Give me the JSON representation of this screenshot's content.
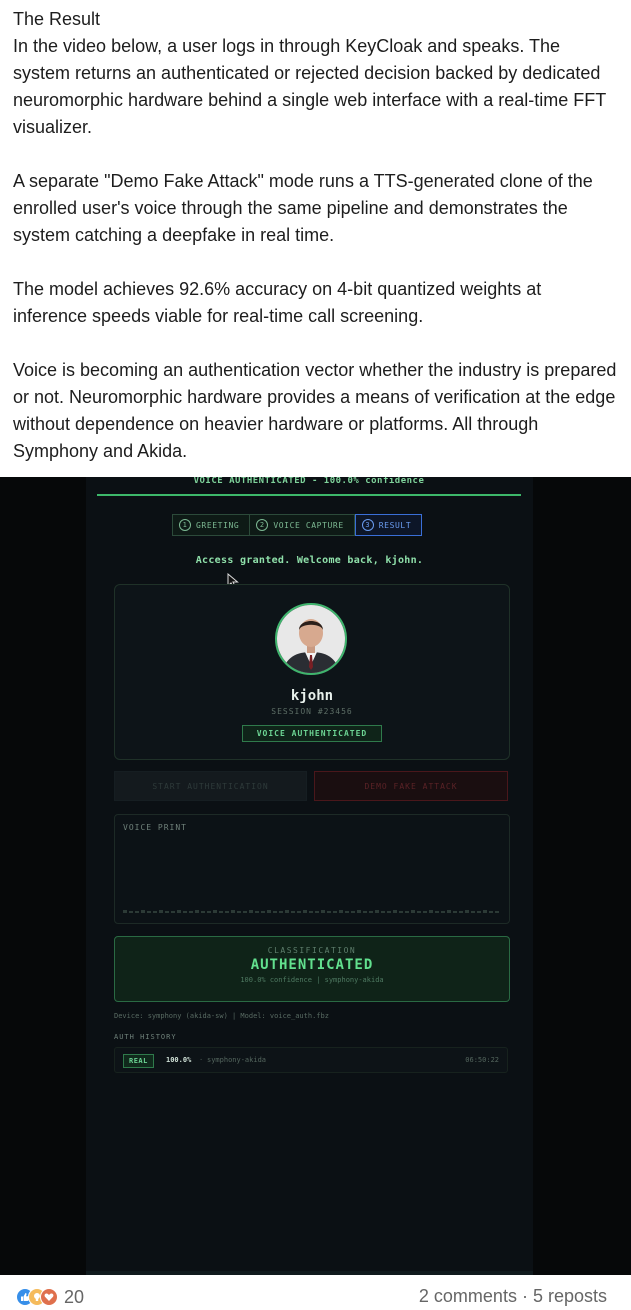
{
  "post": {
    "title": "The Result",
    "paragraphs": [
      "In the video below, a user logs in through KeyCloak and speaks. The system returns an authenticated or rejected decision backed by dedicated neuromorphic hardware behind a single web interface with a real-time FFT visualizer.",
      "A separate \"Demo Fake Attack\" mode runs a TTS-generated clone of the enrolled user's voice through the same pipeline and demonstrates the system catching a deepfake in real time.",
      "The model achieves 92.6% accuracy on 4-bit quantized weights at inference speeds viable for real-time call screening.",
      "Voice is becoming an authentication vector whether the industry is prepared or not. Neuromorphic hardware provides a means of verification at the edge without dependence on heavier hardware or platforms. All through Symphony and Akida."
    ]
  },
  "app": {
    "banner": "VOICE AUTHENTICATED - 100.0% confidence",
    "steps": [
      {
        "num": "1",
        "label": "GREETING"
      },
      {
        "num": "2",
        "label": "VOICE CAPTURE"
      },
      {
        "num": "3",
        "label": "RESULT"
      }
    ],
    "access_message": "Access granted. Welcome back, kjohn.",
    "profile": {
      "username": "kjohn",
      "session": "SESSION #23456",
      "badge": "VOICE AUTHENTICATED"
    },
    "buttons": {
      "start": "START AUTHENTICATION",
      "fake": "DEMO FAKE ATTACK"
    },
    "voice_print": {
      "label": "VOICE PRINT"
    },
    "classification": {
      "label": "CLASSIFICATION",
      "value": "AUTHENTICATED",
      "detail": "100.0% confidence | symphony-akida"
    },
    "device_line": "Device: symphony (akida-sw) | Model: voice_auth.fbz",
    "history": {
      "title": "AUTH HISTORY",
      "rows": [
        {
          "tag": "REAL",
          "confidence": "100.0%",
          "separator": "·",
          "device": "symphony-akida",
          "time": "06:50:22"
        }
      ]
    },
    "colors": {
      "accent_green": "#62e08e",
      "active_step_blue": "#6a9cf0",
      "fake_red": "#5a2226"
    }
  },
  "footer": {
    "reaction_icons": [
      "like-icon",
      "insightful-icon",
      "love-icon"
    ],
    "reaction_count": "20",
    "comments": "2 comments",
    "separator": "·",
    "reposts": "5 reposts"
  }
}
